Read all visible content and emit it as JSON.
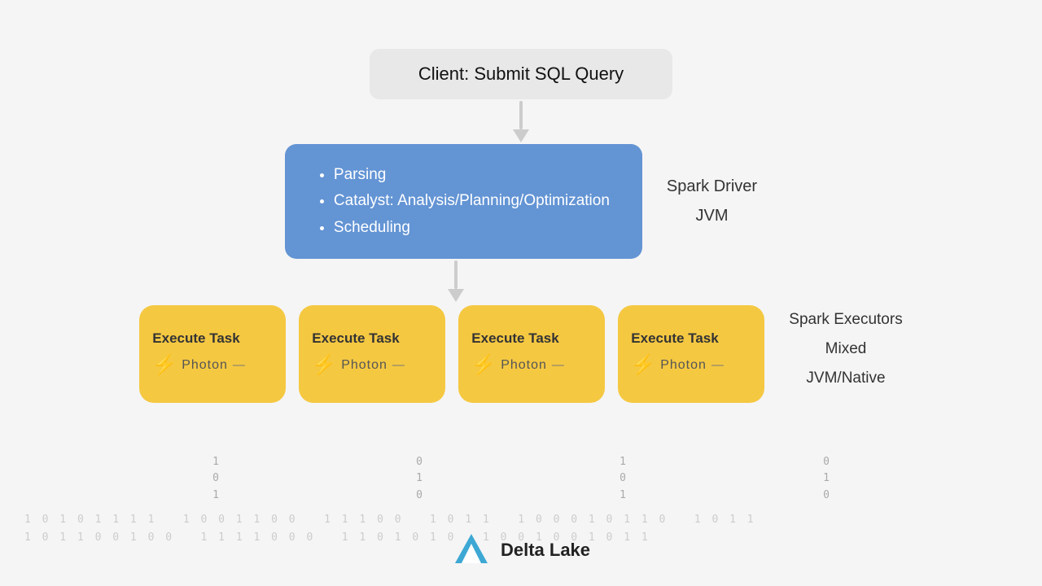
{
  "client": {
    "label": "Client: Submit SQL Query"
  },
  "driver": {
    "bullet1": "Parsing",
    "bullet2": "Catalyst: Analysis/Planning/Optimization",
    "bullet3": "Scheduling",
    "label_line1": "Spark Driver",
    "label_line2": "JVM"
  },
  "executors": {
    "cards": [
      {
        "title": "Execute Task",
        "photon": "Photon",
        "binary": [
          "1",
          "0",
          "1"
        ]
      },
      {
        "title": "Execute Task",
        "photon": "Photon",
        "binary": [
          "0",
          "1",
          "0"
        ]
      },
      {
        "title": "Execute Task",
        "photon": "Photon",
        "binary": [
          "1",
          "0",
          "1"
        ]
      },
      {
        "title": "Execute Task",
        "photon": "Photon",
        "binary": [
          "0",
          "1",
          "0"
        ]
      }
    ],
    "label_line1": "Spark Executors",
    "label_line2": "Mixed",
    "label_line3": "JVM/Native"
  },
  "delta_lake": {
    "text": "Delta Lake"
  },
  "binary_rows": [
    "1 0 1 0 1 1 1 1   1 0 0 1 1 0 0   1 1 1 0 0   1 0 1 1   1 0 0 0 1 0 1 1 0   1 0",
    "1 0 1 1 0 0 1 0 0   1 1 1 1 0 0 0   1 1 0 1 0 1 0 1 0 0 1 0 0 1 0 1 1"
  ]
}
